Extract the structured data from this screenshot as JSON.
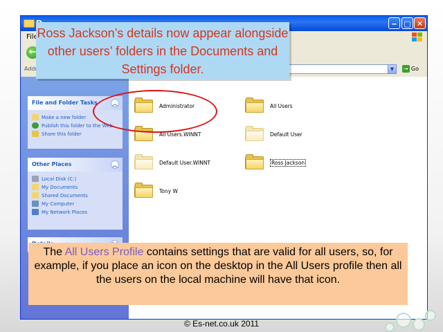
{
  "window": {
    "title": "D",
    "menu_first": "File",
    "address_label": "Addr",
    "go_label": "Go"
  },
  "taskpane": {
    "file_folder_tasks": {
      "title": "File and Folder Tasks",
      "items": [
        "Make a new folder",
        "Publish this folder to the Web",
        "Share this folder"
      ]
    },
    "other_places": {
      "title": "Other Places",
      "items": [
        "Local Disk (C:)",
        "My Documents",
        "Shared Documents",
        "My Computer",
        "My Network Places"
      ]
    },
    "details": {
      "title": "Details"
    }
  },
  "folders": [
    {
      "name": "Administrator"
    },
    {
      "name": "All Users"
    },
    {
      "name": "All Users.WINNT"
    },
    {
      "name": "Default User"
    },
    {
      "name": "Default User.WINNT"
    },
    {
      "name": "Ross Jackson"
    },
    {
      "name": "Tony W"
    }
  ],
  "callouts": {
    "top": "Ross Jackson’s details now appear alongside other users’ folders in the Documents and Settings folder.",
    "bottom_prefix": "The ",
    "bottom_highlight": "All Users Profile",
    "bottom_suffix": " contains settings that are valid for all users, so, for example, if you place an icon on the desktop in the All Users profile then all the users on the local machine will have that icon."
  },
  "footer": {
    "copyright": "© Es-net.co.uk 2011"
  },
  "colors": {
    "accent_red": "#e01010",
    "callout_top_bg": "#aed9f5",
    "callout_top_text": "#d5351c",
    "callout_bottom_bg": "#fbc99a",
    "highlight_text": "#7b59c7"
  }
}
